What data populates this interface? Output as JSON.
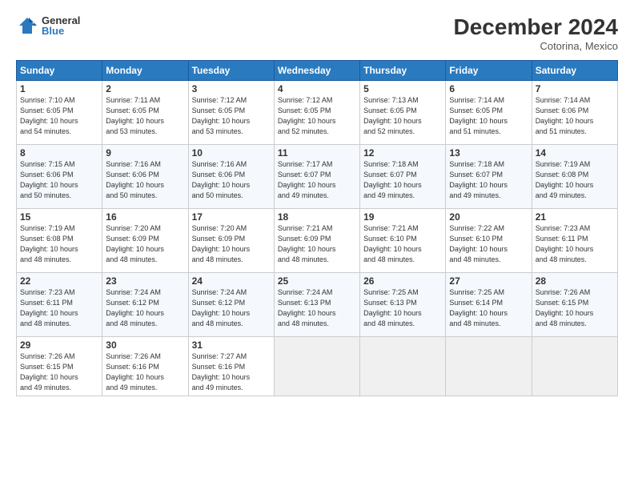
{
  "logo": {
    "general": "General",
    "blue": "Blue"
  },
  "title": "December 2024",
  "location": "Cotorina, Mexico",
  "days_of_week": [
    "Sunday",
    "Monday",
    "Tuesday",
    "Wednesday",
    "Thursday",
    "Friday",
    "Saturday"
  ],
  "weeks": [
    [
      {
        "day": "1",
        "sunrise": "7:10 AM",
        "sunset": "6:05 PM",
        "daylight": "10 hours and 54 minutes."
      },
      {
        "day": "2",
        "sunrise": "7:11 AM",
        "sunset": "6:05 PM",
        "daylight": "10 hours and 53 minutes."
      },
      {
        "day": "3",
        "sunrise": "7:12 AM",
        "sunset": "6:05 PM",
        "daylight": "10 hours and 53 minutes."
      },
      {
        "day": "4",
        "sunrise": "7:12 AM",
        "sunset": "6:05 PM",
        "daylight": "10 hours and 52 minutes."
      },
      {
        "day": "5",
        "sunrise": "7:13 AM",
        "sunset": "6:05 PM",
        "daylight": "10 hours and 52 minutes."
      },
      {
        "day": "6",
        "sunrise": "7:14 AM",
        "sunset": "6:05 PM",
        "daylight": "10 hours and 51 minutes."
      },
      {
        "day": "7",
        "sunrise": "7:14 AM",
        "sunset": "6:06 PM",
        "daylight": "10 hours and 51 minutes."
      }
    ],
    [
      {
        "day": "8",
        "sunrise": "7:15 AM",
        "sunset": "6:06 PM",
        "daylight": "10 hours and 50 minutes."
      },
      {
        "day": "9",
        "sunrise": "7:16 AM",
        "sunset": "6:06 PM",
        "daylight": "10 hours and 50 minutes."
      },
      {
        "day": "10",
        "sunrise": "7:16 AM",
        "sunset": "6:06 PM",
        "daylight": "10 hours and 50 minutes."
      },
      {
        "day": "11",
        "sunrise": "7:17 AM",
        "sunset": "6:07 PM",
        "daylight": "10 hours and 49 minutes."
      },
      {
        "day": "12",
        "sunrise": "7:18 AM",
        "sunset": "6:07 PM",
        "daylight": "10 hours and 49 minutes."
      },
      {
        "day": "13",
        "sunrise": "7:18 AM",
        "sunset": "6:07 PM",
        "daylight": "10 hours and 49 minutes."
      },
      {
        "day": "14",
        "sunrise": "7:19 AM",
        "sunset": "6:08 PM",
        "daylight": "10 hours and 49 minutes."
      }
    ],
    [
      {
        "day": "15",
        "sunrise": "7:19 AM",
        "sunset": "6:08 PM",
        "daylight": "10 hours and 48 minutes."
      },
      {
        "day": "16",
        "sunrise": "7:20 AM",
        "sunset": "6:09 PM",
        "daylight": "10 hours and 48 minutes."
      },
      {
        "day": "17",
        "sunrise": "7:20 AM",
        "sunset": "6:09 PM",
        "daylight": "10 hours and 48 minutes."
      },
      {
        "day": "18",
        "sunrise": "7:21 AM",
        "sunset": "6:09 PM",
        "daylight": "10 hours and 48 minutes."
      },
      {
        "day": "19",
        "sunrise": "7:21 AM",
        "sunset": "6:10 PM",
        "daylight": "10 hours and 48 minutes."
      },
      {
        "day": "20",
        "sunrise": "7:22 AM",
        "sunset": "6:10 PM",
        "daylight": "10 hours and 48 minutes."
      },
      {
        "day": "21",
        "sunrise": "7:23 AM",
        "sunset": "6:11 PM",
        "daylight": "10 hours and 48 minutes."
      }
    ],
    [
      {
        "day": "22",
        "sunrise": "7:23 AM",
        "sunset": "6:11 PM",
        "daylight": "10 hours and 48 minutes."
      },
      {
        "day": "23",
        "sunrise": "7:24 AM",
        "sunset": "6:12 PM",
        "daylight": "10 hours and 48 minutes."
      },
      {
        "day": "24",
        "sunrise": "7:24 AM",
        "sunset": "6:12 PM",
        "daylight": "10 hours and 48 minutes."
      },
      {
        "day": "25",
        "sunrise": "7:24 AM",
        "sunset": "6:13 PM",
        "daylight": "10 hours and 48 minutes."
      },
      {
        "day": "26",
        "sunrise": "7:25 AM",
        "sunset": "6:13 PM",
        "daylight": "10 hours and 48 minutes."
      },
      {
        "day": "27",
        "sunrise": "7:25 AM",
        "sunset": "6:14 PM",
        "daylight": "10 hours and 48 minutes."
      },
      {
        "day": "28",
        "sunrise": "7:26 AM",
        "sunset": "6:15 PM",
        "daylight": "10 hours and 48 minutes."
      }
    ],
    [
      {
        "day": "29",
        "sunrise": "7:26 AM",
        "sunset": "6:15 PM",
        "daylight": "10 hours and 49 minutes."
      },
      {
        "day": "30",
        "sunrise": "7:26 AM",
        "sunset": "6:16 PM",
        "daylight": "10 hours and 49 minutes."
      },
      {
        "day": "31",
        "sunrise": "7:27 AM",
        "sunset": "6:16 PM",
        "daylight": "10 hours and 49 minutes."
      },
      null,
      null,
      null,
      null
    ]
  ],
  "labels": {
    "sunrise": "Sunrise:",
    "sunset": "Sunset:",
    "daylight": "Daylight:"
  }
}
